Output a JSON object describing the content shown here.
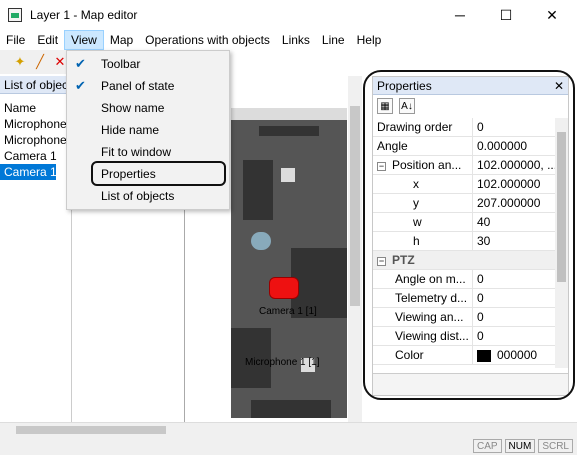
{
  "window": {
    "title": "Layer 1 - Map editor",
    "minimize": "─",
    "maximize": "☐",
    "close": "✕"
  },
  "menu": [
    "File",
    "Edit",
    "View",
    "Map",
    "Operations with objects",
    "Links",
    "Line",
    "Help"
  ],
  "toolbar": {
    "icons": [
      "sparkle-icon",
      "line-tool-icon",
      "delete-icon"
    ]
  },
  "view_menu": {
    "items": [
      {
        "label": "Toolbar",
        "checked": true
      },
      {
        "label": "Panel of state",
        "checked": true
      },
      {
        "label": "Show name",
        "checked": false
      },
      {
        "label": "Hide name",
        "checked": false
      },
      {
        "label": "Fit to window",
        "checked": false
      },
      {
        "label": "Properties",
        "checked": false
      },
      {
        "label": "List of objects",
        "checked": false
      }
    ]
  },
  "left_panel": {
    "title": "List of objec",
    "column": "Name",
    "items": [
      "Microphone",
      "Microphone",
      "Camera 1",
      "Camera 1"
    ],
    "selected_index": 3
  },
  "map": {
    "labels": [
      "Camera 1 [1]",
      "Microphone 1 [1]"
    ]
  },
  "properties": {
    "title": "Properties",
    "close": "✕",
    "rows": [
      {
        "name": "Drawing order",
        "value": "0"
      },
      {
        "name": "Angle",
        "value": "0.000000"
      },
      {
        "name": "Position an...",
        "value": "102.000000, ...",
        "expander": "⊟"
      },
      {
        "name": "x",
        "value": "102.000000"
      },
      {
        "name": "y",
        "value": "207.000000"
      },
      {
        "name": "w",
        "value": "40"
      },
      {
        "name": "h",
        "value": "30"
      },
      {
        "name": "PTZ",
        "value": "",
        "expander": "⊟"
      },
      {
        "name": "Angle on m...",
        "value": "0"
      },
      {
        "name": "Telemetry d...",
        "value": "0"
      },
      {
        "name": "Viewing an...",
        "value": "0"
      },
      {
        "name": "Viewing dist...",
        "value": "0"
      },
      {
        "name": "Color",
        "value": "000000"
      }
    ],
    "color_swatch": "#000000"
  },
  "status": [
    "CAP",
    "NUM",
    "SCRL"
  ],
  "colors": {
    "selection": "#0078d7",
    "menu_active": "#cce8ff",
    "panel_header": "#dfe8f6"
  }
}
